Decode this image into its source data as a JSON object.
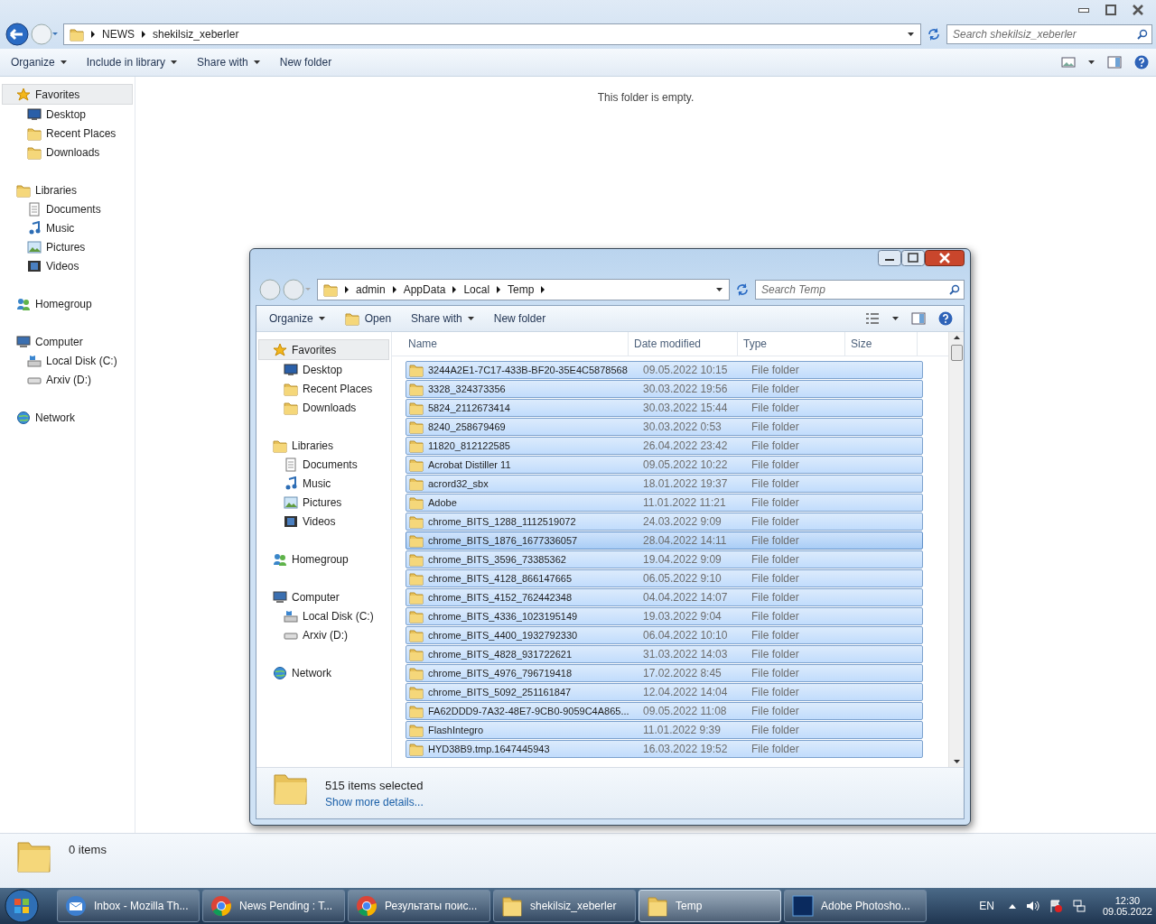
{
  "main_window": {
    "address": [
      "NEWS",
      "shekilsiz_xeberler"
    ],
    "search": {
      "placeholder": "Search shekilsiz_xeberler"
    },
    "toolbar": [
      "Organize",
      "Include in library",
      "Share with",
      "New folder"
    ],
    "sidebar": [
      {
        "label": "Favorites",
        "kind": "favorites",
        "selected": true,
        "children": [
          {
            "label": "Desktop",
            "kind": "desktop"
          },
          {
            "label": "Recent Places",
            "kind": "recent"
          },
          {
            "label": "Downloads",
            "kind": "downloads"
          }
        ]
      },
      {
        "label": "Libraries",
        "kind": "libraries",
        "selected": false,
        "children": [
          {
            "label": "Documents",
            "kind": "documents"
          },
          {
            "label": "Music",
            "kind": "music"
          },
          {
            "label": "Pictures",
            "kind": "pictures"
          },
          {
            "label": "Videos",
            "kind": "videos"
          }
        ]
      },
      {
        "label": "Homegroup",
        "kind": "homegroup",
        "selected": false
      },
      {
        "label": "Computer",
        "kind": "computer",
        "selected": false,
        "children": [
          {
            "label": "Local Disk (C:)",
            "kind": "disk"
          },
          {
            "label": "Arxiv (D:)",
            "kind": "drive"
          }
        ]
      },
      {
        "label": "Network",
        "kind": "network",
        "selected": false
      }
    ],
    "empty_message": "This folder is empty.",
    "status": "0 items"
  },
  "dialog": {
    "address": [
      "admin",
      "AppData",
      "Local",
      "Temp"
    ],
    "search": {
      "placeholder": "Search Temp"
    },
    "toolbar": [
      "Organize",
      "Open",
      "Share with",
      "New folder"
    ],
    "sidebar": [
      {
        "label": "Favorites",
        "kind": "favorites",
        "selected": true,
        "children": [
          {
            "label": "Desktop",
            "kind": "desktop"
          },
          {
            "label": "Recent Places",
            "kind": "recent"
          },
          {
            "label": "Downloads",
            "kind": "downloads"
          }
        ]
      },
      {
        "label": "Libraries",
        "kind": "libraries",
        "selected": false,
        "children": [
          {
            "label": "Documents",
            "kind": "documents"
          },
          {
            "label": "Music",
            "kind": "music"
          },
          {
            "label": "Pictures",
            "kind": "pictures"
          },
          {
            "label": "Videos",
            "kind": "videos"
          }
        ]
      },
      {
        "label": "Homegroup",
        "kind": "homegroup",
        "selected": false
      },
      {
        "label": "Computer",
        "kind": "computer",
        "selected": false,
        "children": [
          {
            "label": "Local Disk (C:)",
            "kind": "disk"
          },
          {
            "label": "Arxiv (D:)",
            "kind": "drive"
          }
        ]
      },
      {
        "label": "Network",
        "kind": "network",
        "selected": false
      }
    ],
    "columns": [
      "Name",
      "Date modified",
      "Type",
      "Size"
    ],
    "rows": [
      {
        "name": "3244A2E1-7C17-433B-BF20-35E4C5878568",
        "date": "09.05.2022 10:15",
        "type": "File folder",
        "selected": true,
        "focused": false
      },
      {
        "name": "3328_324373356",
        "date": "30.03.2022 19:56",
        "type": "File folder",
        "selected": true,
        "focused": false
      },
      {
        "name": "5824_2112673414",
        "date": "30.03.2022 15:44",
        "type": "File folder",
        "selected": true,
        "focused": false
      },
      {
        "name": "8240_258679469",
        "date": "30.03.2022 0:53",
        "type": "File folder",
        "selected": true,
        "focused": false
      },
      {
        "name": "11820_812122585",
        "date": "26.04.2022 23:42",
        "type": "File folder",
        "selected": true,
        "focused": false
      },
      {
        "name": "Acrobat Distiller 11",
        "date": "09.05.2022 10:22",
        "type": "File folder",
        "selected": true,
        "focused": false
      },
      {
        "name": "acrord32_sbx",
        "date": "18.01.2022 19:37",
        "type": "File folder",
        "selected": true,
        "focused": false
      },
      {
        "name": "Adobe",
        "date": "11.01.2022 11:21",
        "type": "File folder",
        "selected": true,
        "focused": false
      },
      {
        "name": "chrome_BITS_1288_1112519072",
        "date": "24.03.2022 9:09",
        "type": "File folder",
        "selected": true,
        "focused": false
      },
      {
        "name": "chrome_BITS_1876_1677336057",
        "date": "28.04.2022 14:11",
        "type": "File folder",
        "selected": true,
        "focused": true
      },
      {
        "name": "chrome_BITS_3596_73385362",
        "date": "19.04.2022 9:09",
        "type": "File folder",
        "selected": true,
        "focused": false
      },
      {
        "name": "chrome_BITS_4128_866147665",
        "date": "06.05.2022 9:10",
        "type": "File folder",
        "selected": true,
        "focused": false
      },
      {
        "name": "chrome_BITS_4152_762442348",
        "date": "04.04.2022 14:07",
        "type": "File folder",
        "selected": true,
        "focused": false
      },
      {
        "name": "chrome_BITS_4336_1023195149",
        "date": "19.03.2022 9:04",
        "type": "File folder",
        "selected": true,
        "focused": false
      },
      {
        "name": "chrome_BITS_4400_1932792330",
        "date": "06.04.2022 10:10",
        "type": "File folder",
        "selected": true,
        "focused": false
      },
      {
        "name": "chrome_BITS_4828_931722621",
        "date": "31.03.2022 14:03",
        "type": "File folder",
        "selected": true,
        "focused": false
      },
      {
        "name": "chrome_BITS_4976_796719418",
        "date": "17.02.2022 8:45",
        "type": "File folder",
        "selected": true,
        "focused": false
      },
      {
        "name": "chrome_BITS_5092_251161847",
        "date": "12.04.2022 14:04",
        "type": "File folder",
        "selected": true,
        "focused": false
      },
      {
        "name": "FA62DDD9-7A32-48E7-9CB0-9059C4A865...",
        "date": "09.05.2022 11:08",
        "type": "File folder",
        "selected": true,
        "focused": false
      },
      {
        "name": "FlashIntegro",
        "date": "11.01.2022 9:39",
        "type": "File folder",
        "selected": true,
        "focused": false
      },
      {
        "name": "HYD38B9.tmp.1647445943",
        "date": "16.03.2022 19:52",
        "type": "File folder",
        "selected": true,
        "focused": false
      }
    ],
    "status": "515 items selected",
    "details_link": "Show more details..."
  },
  "taskbar": {
    "buttons": [
      {
        "label": "Inbox - Mozilla Th...",
        "kind": "mail",
        "selected": false
      },
      {
        "label": "News Pending : T...",
        "kind": "browser",
        "selected": false
      },
      {
        "label": "Результаты поис...",
        "kind": "browser",
        "selected": false
      },
      {
        "label": "shekilsiz_xeberler",
        "kind": "folder",
        "selected": false
      },
      {
        "label": "Temp",
        "kind": "folder",
        "selected": true
      },
      {
        "label": "Adobe Photosho...",
        "kind": "photoshop",
        "selected": false
      }
    ],
    "language": "EN",
    "time": "12:30",
    "date": "09.05.2022"
  }
}
